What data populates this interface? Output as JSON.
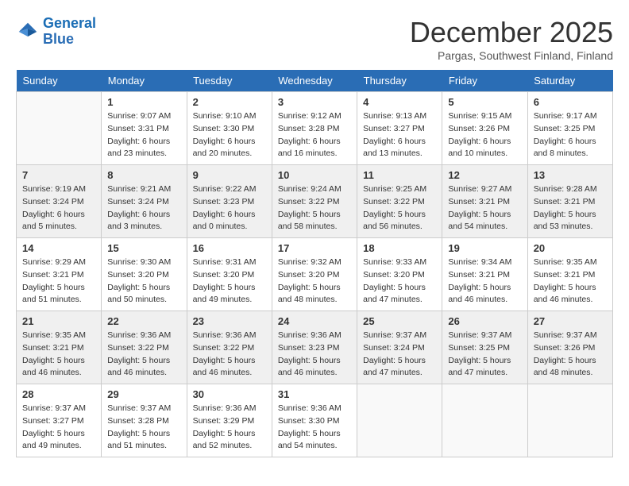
{
  "logo": {
    "line1": "General",
    "line2": "Blue"
  },
  "title": "December 2025",
  "location": "Pargas, Southwest Finland, Finland",
  "days_of_week": [
    "Sunday",
    "Monday",
    "Tuesday",
    "Wednesday",
    "Thursday",
    "Friday",
    "Saturday"
  ],
  "weeks": [
    [
      {
        "day": "",
        "sunrise": "",
        "sunset": "",
        "daylight": ""
      },
      {
        "day": "1",
        "sunrise": "Sunrise: 9:07 AM",
        "sunset": "Sunset: 3:31 PM",
        "daylight": "Daylight: 6 hours and 23 minutes."
      },
      {
        "day": "2",
        "sunrise": "Sunrise: 9:10 AM",
        "sunset": "Sunset: 3:30 PM",
        "daylight": "Daylight: 6 hours and 20 minutes."
      },
      {
        "day": "3",
        "sunrise": "Sunrise: 9:12 AM",
        "sunset": "Sunset: 3:28 PM",
        "daylight": "Daylight: 6 hours and 16 minutes."
      },
      {
        "day": "4",
        "sunrise": "Sunrise: 9:13 AM",
        "sunset": "Sunset: 3:27 PM",
        "daylight": "Daylight: 6 hours and 13 minutes."
      },
      {
        "day": "5",
        "sunrise": "Sunrise: 9:15 AM",
        "sunset": "Sunset: 3:26 PM",
        "daylight": "Daylight: 6 hours and 10 minutes."
      },
      {
        "day": "6",
        "sunrise": "Sunrise: 9:17 AM",
        "sunset": "Sunset: 3:25 PM",
        "daylight": "Daylight: 6 hours and 8 minutes."
      }
    ],
    [
      {
        "day": "7",
        "sunrise": "Sunrise: 9:19 AM",
        "sunset": "Sunset: 3:24 PM",
        "daylight": "Daylight: 6 hours and 5 minutes."
      },
      {
        "day": "8",
        "sunrise": "Sunrise: 9:21 AM",
        "sunset": "Sunset: 3:24 PM",
        "daylight": "Daylight: 6 hours and 3 minutes."
      },
      {
        "day": "9",
        "sunrise": "Sunrise: 9:22 AM",
        "sunset": "Sunset: 3:23 PM",
        "daylight": "Daylight: 6 hours and 0 minutes."
      },
      {
        "day": "10",
        "sunrise": "Sunrise: 9:24 AM",
        "sunset": "Sunset: 3:22 PM",
        "daylight": "Daylight: 5 hours and 58 minutes."
      },
      {
        "day": "11",
        "sunrise": "Sunrise: 9:25 AM",
        "sunset": "Sunset: 3:22 PM",
        "daylight": "Daylight: 5 hours and 56 minutes."
      },
      {
        "day": "12",
        "sunrise": "Sunrise: 9:27 AM",
        "sunset": "Sunset: 3:21 PM",
        "daylight": "Daylight: 5 hours and 54 minutes."
      },
      {
        "day": "13",
        "sunrise": "Sunrise: 9:28 AM",
        "sunset": "Sunset: 3:21 PM",
        "daylight": "Daylight: 5 hours and 53 minutes."
      }
    ],
    [
      {
        "day": "14",
        "sunrise": "Sunrise: 9:29 AM",
        "sunset": "Sunset: 3:21 PM",
        "daylight": "Daylight: 5 hours and 51 minutes."
      },
      {
        "day": "15",
        "sunrise": "Sunrise: 9:30 AM",
        "sunset": "Sunset: 3:20 PM",
        "daylight": "Daylight: 5 hours and 50 minutes."
      },
      {
        "day": "16",
        "sunrise": "Sunrise: 9:31 AM",
        "sunset": "Sunset: 3:20 PM",
        "daylight": "Daylight: 5 hours and 49 minutes."
      },
      {
        "day": "17",
        "sunrise": "Sunrise: 9:32 AM",
        "sunset": "Sunset: 3:20 PM",
        "daylight": "Daylight: 5 hours and 48 minutes."
      },
      {
        "day": "18",
        "sunrise": "Sunrise: 9:33 AM",
        "sunset": "Sunset: 3:20 PM",
        "daylight": "Daylight: 5 hours and 47 minutes."
      },
      {
        "day": "19",
        "sunrise": "Sunrise: 9:34 AM",
        "sunset": "Sunset: 3:21 PM",
        "daylight": "Daylight: 5 hours and 46 minutes."
      },
      {
        "day": "20",
        "sunrise": "Sunrise: 9:35 AM",
        "sunset": "Sunset: 3:21 PM",
        "daylight": "Daylight: 5 hours and 46 minutes."
      }
    ],
    [
      {
        "day": "21",
        "sunrise": "Sunrise: 9:35 AM",
        "sunset": "Sunset: 3:21 PM",
        "daylight": "Daylight: 5 hours and 46 minutes."
      },
      {
        "day": "22",
        "sunrise": "Sunrise: 9:36 AM",
        "sunset": "Sunset: 3:22 PM",
        "daylight": "Daylight: 5 hours and 46 minutes."
      },
      {
        "day": "23",
        "sunrise": "Sunrise: 9:36 AM",
        "sunset": "Sunset: 3:22 PM",
        "daylight": "Daylight: 5 hours and 46 minutes."
      },
      {
        "day": "24",
        "sunrise": "Sunrise: 9:36 AM",
        "sunset": "Sunset: 3:23 PM",
        "daylight": "Daylight: 5 hours and 46 minutes."
      },
      {
        "day": "25",
        "sunrise": "Sunrise: 9:37 AM",
        "sunset": "Sunset: 3:24 PM",
        "daylight": "Daylight: 5 hours and 47 minutes."
      },
      {
        "day": "26",
        "sunrise": "Sunrise: 9:37 AM",
        "sunset": "Sunset: 3:25 PM",
        "daylight": "Daylight: 5 hours and 47 minutes."
      },
      {
        "day": "27",
        "sunrise": "Sunrise: 9:37 AM",
        "sunset": "Sunset: 3:26 PM",
        "daylight": "Daylight: 5 hours and 48 minutes."
      }
    ],
    [
      {
        "day": "28",
        "sunrise": "Sunrise: 9:37 AM",
        "sunset": "Sunset: 3:27 PM",
        "daylight": "Daylight: 5 hours and 49 minutes."
      },
      {
        "day": "29",
        "sunrise": "Sunrise: 9:37 AM",
        "sunset": "Sunset: 3:28 PM",
        "daylight": "Daylight: 5 hours and 51 minutes."
      },
      {
        "day": "30",
        "sunrise": "Sunrise: 9:36 AM",
        "sunset": "Sunset: 3:29 PM",
        "daylight": "Daylight: 5 hours and 52 minutes."
      },
      {
        "day": "31",
        "sunrise": "Sunrise: 9:36 AM",
        "sunset": "Sunset: 3:30 PM",
        "daylight": "Daylight: 5 hours and 54 minutes."
      },
      {
        "day": "",
        "sunrise": "",
        "sunset": "",
        "daylight": ""
      },
      {
        "day": "",
        "sunrise": "",
        "sunset": "",
        "daylight": ""
      },
      {
        "day": "",
        "sunrise": "",
        "sunset": "",
        "daylight": ""
      }
    ]
  ]
}
